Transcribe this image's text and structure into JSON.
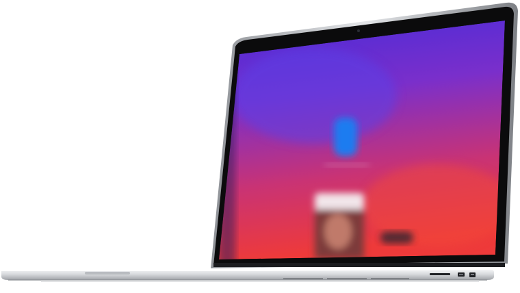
{
  "scene": {
    "object": "laptop",
    "background_color": "#ffffff",
    "bezel_color": "#0b0b0c",
    "lid_edge_color": "#c9cbce",
    "base_color": "#dcdee1",
    "screen_gradient": [
      "#4a2bd8",
      "#8a2fc2",
      "#e0345a",
      "#ee3a3a"
    ],
    "screen_content": {
      "blurred": true,
      "app_icon_color": "#1e7cf0",
      "icons": [
        "app-icon",
        "photo-thumbnail",
        "button-shape"
      ]
    },
    "ports": [
      "sd-card-slot",
      "hdmi-port",
      "usb-port"
    ]
  }
}
